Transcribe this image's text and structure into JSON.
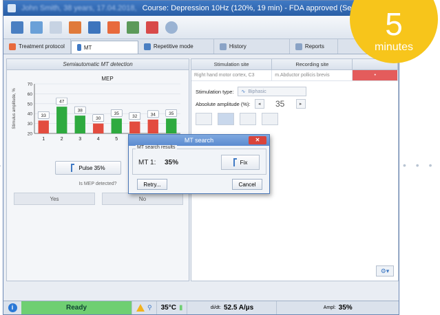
{
  "window": {
    "title_blurred": "John Smith, 38 years, 17.04.2018,",
    "title": "Course: Depression 10Hz (120%, 19 min) - FDA approved (Session 1)"
  },
  "tabs": [
    {
      "label": "Treatment protocol",
      "active": false
    },
    {
      "label": "MT",
      "active": true
    },
    {
      "label": "Repetitive mode",
      "active": false
    },
    {
      "label": "History",
      "active": false
    },
    {
      "label": "Reports",
      "active": false
    }
  ],
  "left_panel": {
    "header": "Semiautomatic MT detection",
    "pulse_button": "Pulse  35%",
    "question": "Is MEP detected?",
    "yes": "Yes",
    "no": "No"
  },
  "chart_data": {
    "type": "bar",
    "title": "MEP",
    "ylabel": "Stimulus amplitude, %",
    "ylim": [
      20,
      70
    ],
    "yticks": [
      20,
      30,
      40,
      50,
      60,
      70
    ],
    "categories": [
      "1",
      "2",
      "3",
      "4",
      "5",
      "6",
      "7",
      "8"
    ],
    "values": [
      33,
      47,
      38,
      30,
      35,
      32,
      34,
      35
    ],
    "detected": [
      false,
      true,
      true,
      false,
      true,
      false,
      false,
      true
    ],
    "colors": {
      "detected": "#2eaa3f",
      "not_detected": "#e34c3f"
    }
  },
  "right_panel": {
    "col_stimulation_site": "Stimulation site",
    "col_recording_site": "Recording site",
    "row_stimulation_site": "Right hand motor cortex, C3",
    "row_recording_site": "m.Abductor pollicis brevis",
    "stim_type_label": "Stimulation type:",
    "stim_type_value": "Biphasic",
    "abs_amp_label": "Absolute amplitude (%):",
    "abs_amp_value": "35"
  },
  "dialog": {
    "title": "MT search",
    "group": "MT search results",
    "mt_label": "MT 1:",
    "mt_value": "35%",
    "fix": "Fix",
    "retry": "Retry...",
    "cancel": "Cancel"
  },
  "status": {
    "ready": "Ready",
    "temperature": "35°C",
    "didt_label": "di/dt:",
    "didt_value": "52.5 A/µs",
    "ampl_label": "Ampl:",
    "ampl_value": "35%"
  },
  "badge": {
    "number": "5",
    "unit": "minutes"
  }
}
